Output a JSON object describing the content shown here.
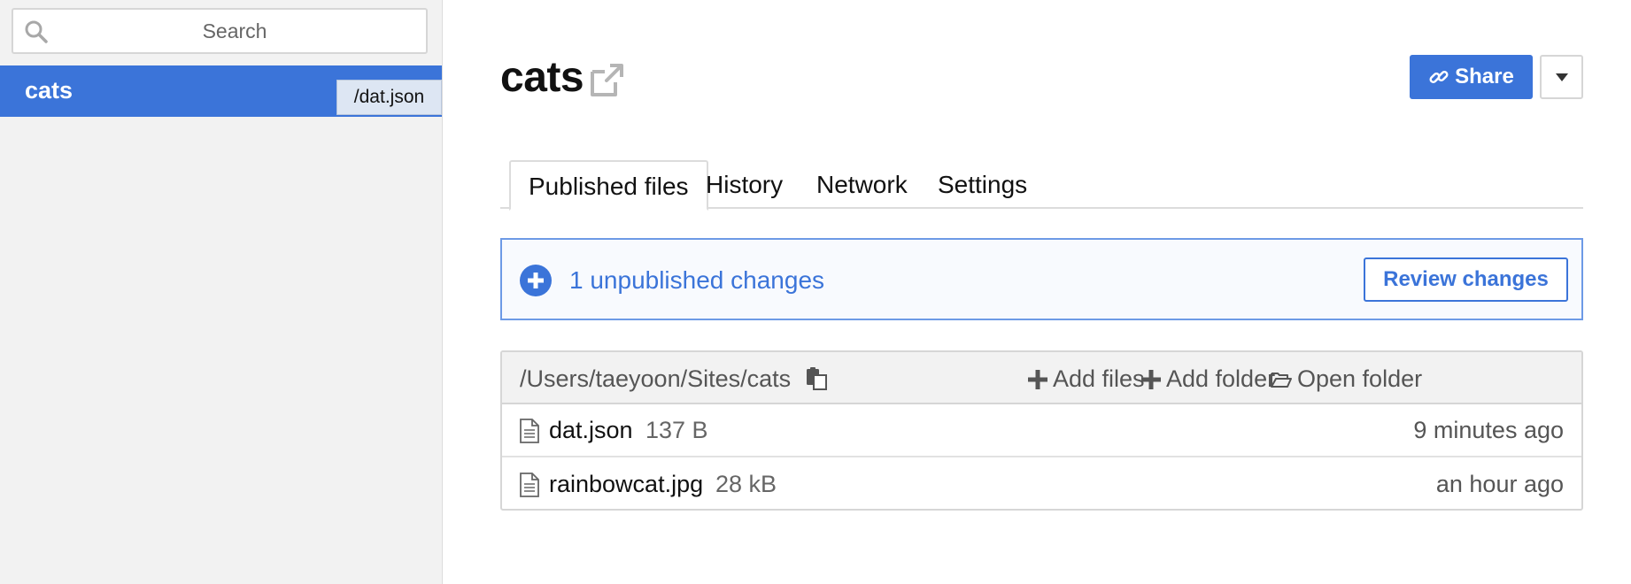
{
  "search": {
    "placeholder": "Search"
  },
  "archives": [
    {
      "title": "cats",
      "tooltip": "/dat.json"
    }
  ],
  "header": {
    "title": "cats",
    "share_label": "Share"
  },
  "tabs": [
    {
      "label": "Published files",
      "active": true
    },
    {
      "label": "History",
      "active": false
    },
    {
      "label": "Network",
      "active": false
    },
    {
      "label": "Settings",
      "active": false
    }
  ],
  "notice": {
    "text": "1 unpublished changes",
    "review_label": "Review changes"
  },
  "files": {
    "path": "/Users/taeyoon/Sites/cats",
    "actions": {
      "add_files": "Add files",
      "add_folder": "Add folder",
      "open_folder": "Open folder"
    },
    "rows": [
      {
        "name": "dat.json",
        "size": "137 B",
        "modified": "9 minutes ago"
      },
      {
        "name": "rainbowcat.jpg",
        "size": "28 kB",
        "modified": "an hour ago"
      }
    ]
  },
  "colors": {
    "accent": "#3b74d9",
    "sidebar_bg": "#f2f2f2",
    "notice_border": "#6d9ae6"
  },
  "icons": {
    "search": "search-icon",
    "external": "external-link-icon",
    "share": "link-icon",
    "dropdown": "caret-down-icon",
    "notice": "plus-circle-icon",
    "copy": "clipboard-icon",
    "add": "plus-icon",
    "folder": "folder-open-icon",
    "file": "file-icon"
  }
}
